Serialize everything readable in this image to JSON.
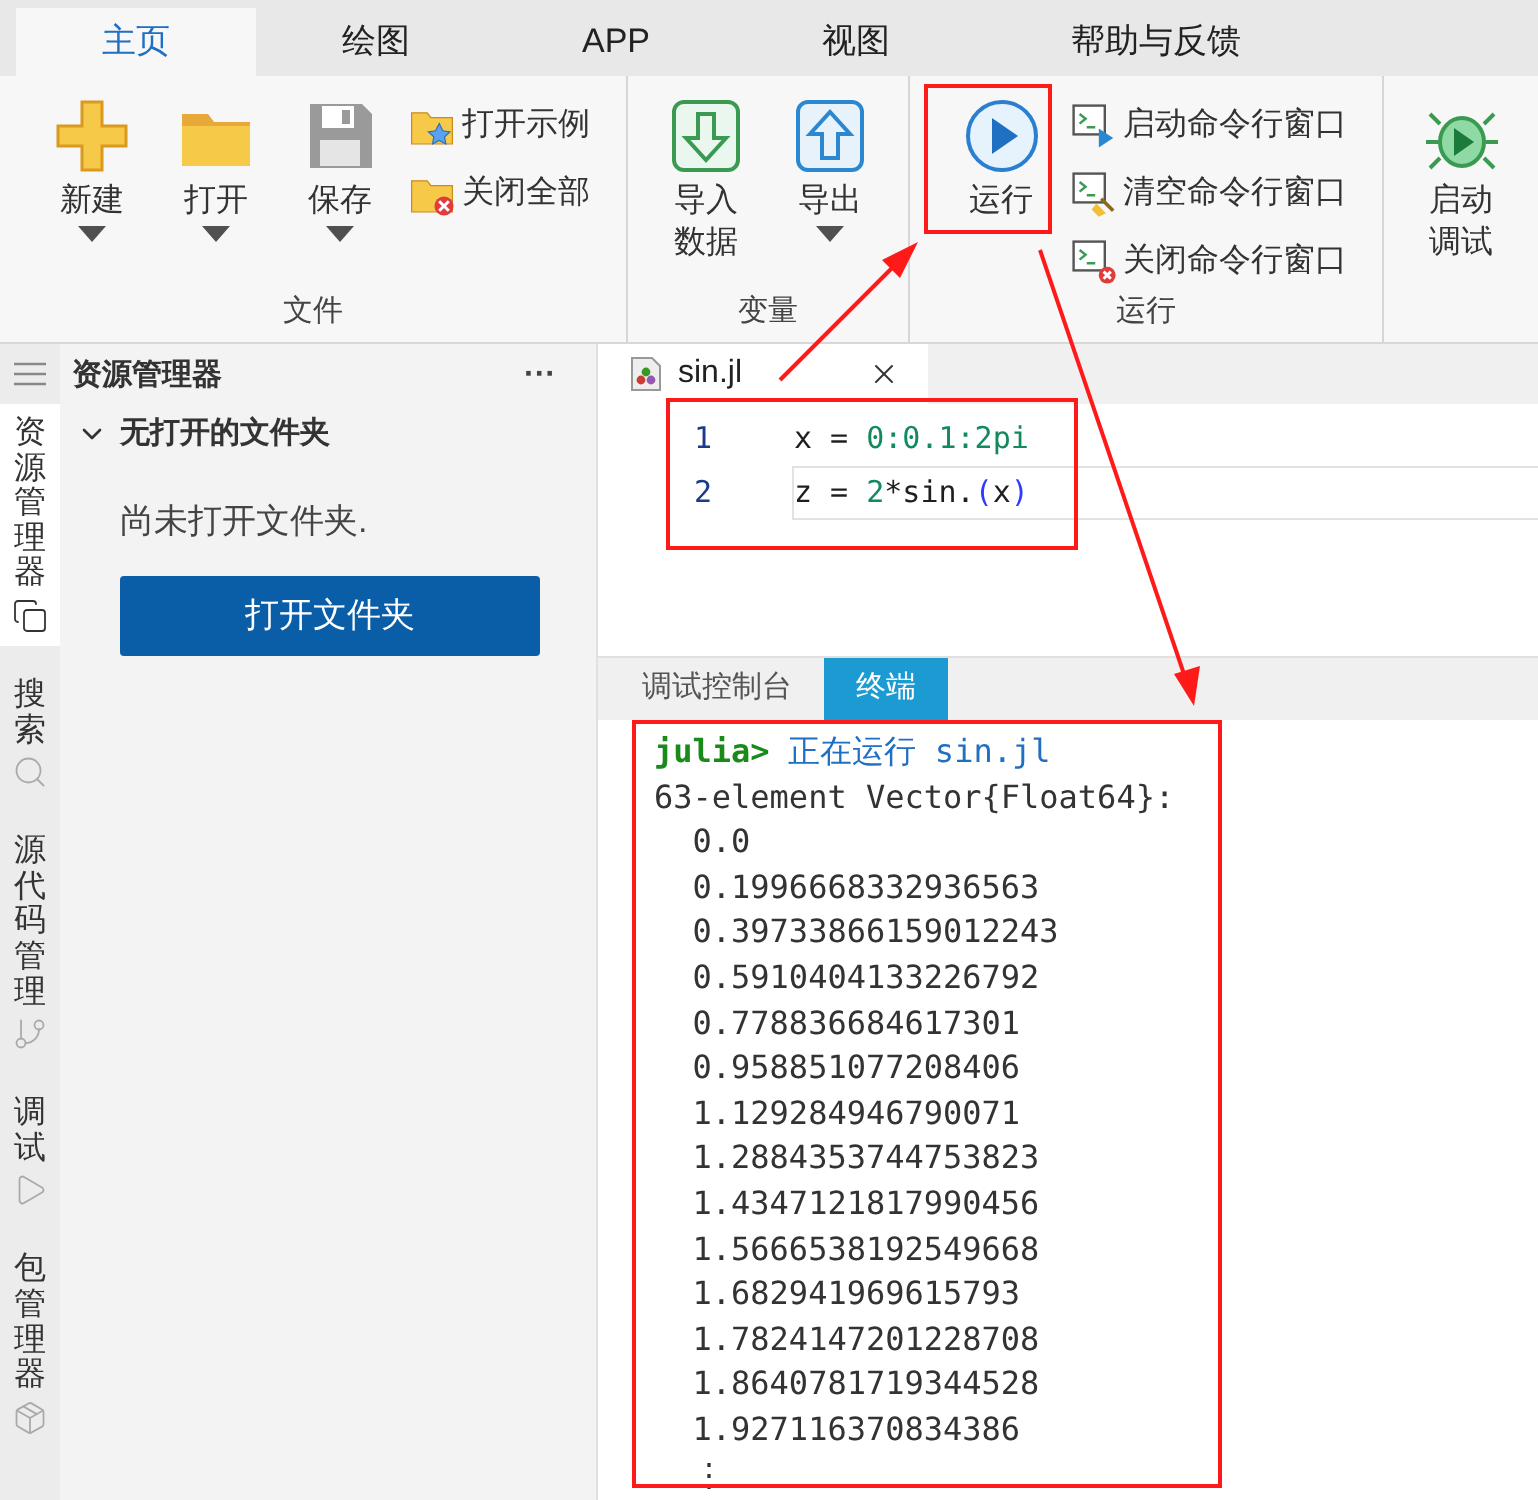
{
  "ribbon": {
    "tabs": [
      {
        "label": "主页",
        "selected": true
      },
      {
        "label": "绘图",
        "selected": false
      },
      {
        "label": "APP",
        "selected": false
      },
      {
        "label": "视图",
        "selected": false
      },
      {
        "label": "帮助与反馈",
        "selected": false
      }
    ],
    "groups": [
      {
        "label": "文件",
        "items": [
          {
            "kind": "large",
            "label": "新建",
            "dropdown": true
          },
          {
            "kind": "large",
            "label": "打开",
            "dropdown": true
          },
          {
            "kind": "large",
            "label": "保存",
            "dropdown": true
          },
          {
            "kind": "small",
            "label": "打开示例"
          },
          {
            "kind": "small",
            "label": "关闭全部"
          }
        ]
      },
      {
        "label": "变量",
        "items": [
          {
            "kind": "large",
            "label": "导入数据",
            "dropdown": false
          },
          {
            "kind": "large",
            "label": "导出",
            "dropdown": true
          }
        ]
      },
      {
        "label": "运行",
        "items": [
          {
            "kind": "large",
            "label": "运行",
            "dropdown": false
          },
          {
            "kind": "small",
            "label": "启动命令行窗口"
          },
          {
            "kind": "small",
            "label": "清空命令行窗口"
          },
          {
            "kind": "small",
            "label": "关闭命令行窗口"
          }
        ]
      },
      {
        "items": [
          {
            "kind": "large",
            "label": "启动调试",
            "dropdown": false
          }
        ]
      }
    ]
  },
  "activity_bar": [
    {
      "label": "资源管理器",
      "selected": true
    },
    {
      "label": "搜索",
      "selected": false
    },
    {
      "label": "源代码管理",
      "selected": false
    },
    {
      "label": "调试",
      "selected": false
    },
    {
      "label": "包管理器",
      "selected": false
    }
  ],
  "explorer": {
    "title": "资源管理器",
    "more": "···",
    "section": {
      "label": "无打开的文件夹",
      "expanded": true
    },
    "message": "尚未打开文件夹.",
    "button": "打开文件夹"
  },
  "editor": {
    "tab": {
      "label": "sin.jl"
    },
    "lines": [
      {
        "number": "1",
        "current": false,
        "tokens": [
          {
            "kind": "plain",
            "text": "x = "
          },
          {
            "kind": "number",
            "text": "0:0.1:2pi"
          }
        ]
      },
      {
        "number": "2",
        "current": true,
        "tokens": [
          {
            "kind": "plain",
            "text": "z = "
          },
          {
            "kind": "number",
            "text": "2"
          },
          {
            "kind": "plain",
            "text": "*sin."
          },
          {
            "kind": "paren",
            "text": "("
          },
          {
            "kind": "plain",
            "text": "x"
          },
          {
            "kind": "paren",
            "text": ")"
          }
        ]
      }
    ]
  },
  "panel": {
    "tabs": [
      {
        "label": "调试控制台",
        "selected": false
      },
      {
        "label": "终端",
        "selected": true
      }
    ],
    "terminal": {
      "prompt": "julia>",
      "command": "正在运行 sin.jl",
      "output": [
        "63-element Vector{Float64}:",
        "  0.0",
        "  0.1996668332936563",
        "  0.39733866159012243",
        "  0.5910404133226792",
        "  0.778836684617301",
        "  0.958851077208406",
        "  1.129284946790071",
        "  1.2884353744753823",
        "  1.4347121817990456",
        "  1.5666538192549668",
        "  1.682941969615793",
        "  1.7824147201228708",
        "  1.8640781719344528",
        "  1.927116370834386",
        "  ⋮"
      ]
    }
  }
}
